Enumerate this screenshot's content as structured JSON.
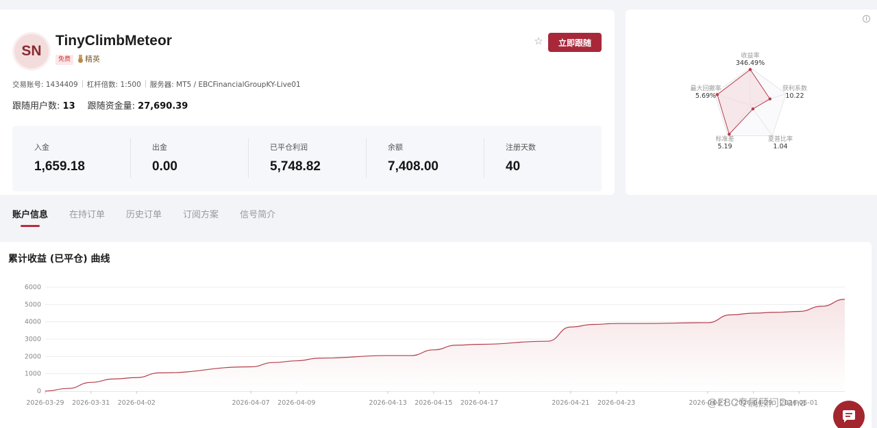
{
  "profile": {
    "initials": "SN",
    "name": "TinyClimbMeteor",
    "tag_free": "免费",
    "tag_elite": "精英",
    "follow_button": "立即跟随",
    "account": "交易账号: 1434409",
    "leverage": "杠杆倍数: 1:500",
    "server": "服务器: MT5 / EBCFinancialGroupKY-Live01",
    "followers_label": "跟随用户数:",
    "followers_value": "13",
    "funds_label": "跟随资金量:",
    "funds_value": "27,690.39"
  },
  "stats": [
    {
      "label": "入金",
      "value": "1,659.18"
    },
    {
      "label": "出金",
      "value": "0.00"
    },
    {
      "label": "已平仓利润",
      "value": "5,748.82"
    },
    {
      "label": "余额",
      "value": "7,408.00"
    },
    {
      "label": "注册天数",
      "value": "40"
    }
  ],
  "radar": {
    "axes": [
      {
        "label": "收益率",
        "value": "346.49%",
        "level": 0.95
      },
      {
        "label": "获利系数",
        "value": "10.22",
        "level": 0.55
      },
      {
        "label": "夏普比率",
        "value": "1.04",
        "level": 0.12
      },
      {
        "label": "标准差",
        "value": "5.19",
        "level": 0.95
      },
      {
        "label": "最大回撤率",
        "value": "5.69%",
        "level": 0.92
      }
    ],
    "colors": {
      "line": "#b83a4a",
      "fill": "#f4dadd",
      "grid": "#e6e6e6"
    }
  },
  "tabs": [
    "账户信息",
    "在持订单",
    "历史订单",
    "订阅方案",
    "信号简介"
  ],
  "chart_title": "累计收益 (已平仓) 曲线",
  "chart_data": {
    "type": "area",
    "ylim": [
      0,
      6000
    ],
    "yticks": [
      0,
      1000,
      2000,
      3000,
      4000,
      5000,
      6000
    ],
    "x_ticks": [
      "2026-03-29",
      "2026-03-31",
      "2026-04-02",
      "2026-04-07",
      "2026-04-09",
      "2026-04-13",
      "2026-04-15",
      "2026-04-17",
      "2026-04-21",
      "2026-04-23",
      "2026-04-27",
      "2026-04-29",
      "2026-05-01"
    ],
    "x": [
      "2026-03-29",
      "2026-03-30",
      "2026-03-31",
      "2026-04-01",
      "2026-04-02",
      "2026-04-03",
      "2026-04-07",
      "2026-04-08",
      "2026-04-09",
      "2026-04-10",
      "2026-04-13",
      "2026-04-14",
      "2026-04-15",
      "2026-04-16",
      "2026-04-17",
      "2026-04-20",
      "2026-04-21",
      "2026-04-22",
      "2026-04-23",
      "2026-04-24",
      "2026-04-27",
      "2026-04-28",
      "2026-04-29",
      "2026-04-30",
      "2026-05-01",
      "2026-05-02",
      "2026-05-03"
    ],
    "values": [
      0,
      150,
      500,
      700,
      780,
      1050,
      1400,
      1650,
      1750,
      1900,
      2050,
      2050,
      2380,
      2650,
      2700,
      2880,
      3700,
      3850,
      3900,
      3900,
      3950,
      4400,
      4500,
      4550,
      4600,
      4900,
      5300,
      5850
    ],
    "colors": {
      "line": "#b33c48",
      "fill_top": "#f6e3e5",
      "grid": "#ececec"
    }
  },
  "watermark": "@EBC专属顾问Dana"
}
